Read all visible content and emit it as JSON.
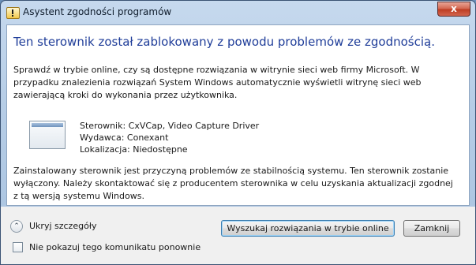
{
  "window": {
    "title": "Asystent zgodności programów",
    "close_glyph": "x"
  },
  "content": {
    "heading": "Ten sterownik został zablokowany z powodu problemów ze zgodnością.",
    "description": "Sprawdź w trybie online, czy są dostępne rozwiązania w witrynie sieci web firmy Microsoft. W przypadku znalezienia rozwiązań System Windows automatycznie wyświetli witrynę sieci web zawierającą kroki do wykonania przez użytkownika.",
    "driver": {
      "line1": "Sterownik: CxVCap, Video Capture Driver",
      "line2": "Wydawca: Conexant",
      "line3": "Lokalizacja: Niedostępne"
    },
    "explanation": "Zainstalowany sterownik jest przyczyną problemów ze stabilnością systemu. Ten sterownik zostanie wyłączony. Należy skontaktować się z producentem sterownika w celu uzyskania aktualizacji zgodnej z tą wersją systemu Windows."
  },
  "footer": {
    "details_toggle_label": "Ukryj szczegóły",
    "details_toggle_glyph": "⌃",
    "checkbox_label": "Nie pokazuj tego komunikatu ponownie",
    "checkbox_checked": false,
    "primary_button": "Wyszukaj rozwiązania w trybie online",
    "close_button": "Zamknij"
  }
}
